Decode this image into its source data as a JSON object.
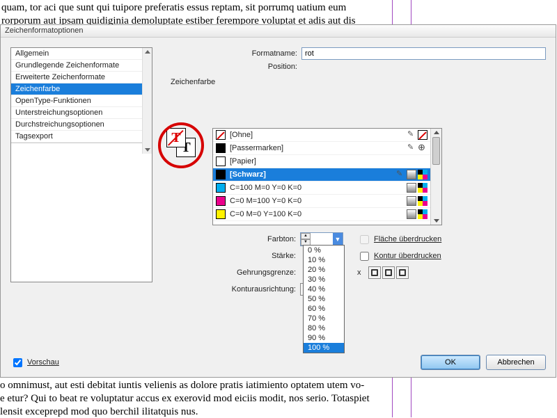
{
  "background": {
    "top": "quam, tor aci que sunt qui tuipore preferatis essus reptam, sit porrumq uatium eum\nrorporum aut ipsam quidiginia demoluptate estiber ferempore voluptat et adis aut dis",
    "bottom": "o omnimust, aut esti debitat iuntis velienis as dolore pratis iatimiento optatem utem vo-\ne etur? Qui to beat re voluptatur accus ex exerovid mod eiciis modit, nos serio. Totaspiet\nlensit exceprepd mod quo berchil ilitatquis nus."
  },
  "dialog": {
    "title": "Zeichenformatoptionen",
    "sidebar": {
      "items": [
        {
          "label": "Allgemein"
        },
        {
          "label": "Grundlegende Zeichenformate"
        },
        {
          "label": "Erweiterte Zeichenformate"
        },
        {
          "label": "Zeichenfarbe"
        },
        {
          "label": "OpenType-Funktionen"
        },
        {
          "label": "Unterstreichungsoptionen"
        },
        {
          "label": "Durchstreichungsoptionen"
        },
        {
          "label": "Tagsexport"
        }
      ],
      "selected_index": 3
    },
    "fields": {
      "formatname_label": "Formatname:",
      "formatname_value": "rot",
      "position_label": "Position:",
      "section_label": "Zeichenfarbe"
    },
    "swatches": [
      {
        "name": "[Ohne]",
        "type": "none"
      },
      {
        "name": "[Passermarken]",
        "type": "registration"
      },
      {
        "name": "[Papier]",
        "type": "paper"
      },
      {
        "name": "[Schwarz]",
        "type": "black",
        "selected": true
      },
      {
        "name": "C=100 M=0 Y=0 K=0",
        "type": "cyan"
      },
      {
        "name": "C=0 M=100 Y=0 K=0",
        "type": "magenta"
      },
      {
        "name": "C=0 M=0 Y=100 K=0",
        "type": "yellow"
      }
    ],
    "controls": {
      "tint_label": "Farbton:",
      "weight_label": "Stärke:",
      "miter_label": "Gehrungsgrenze:",
      "align_label": "Konturausrichtung:",
      "miter_x": "x",
      "overprint_fill": "Fläche überdrucken",
      "overprint_stroke": "Kontur überdrucken",
      "dropdown_options": [
        "0 %",
        "10 %",
        "20 %",
        "30 %",
        "40 %",
        "50 %",
        "60 %",
        "70 %",
        "80 %",
        "90 %",
        "100 %"
      ],
      "dropdown_selected": "100 %"
    },
    "footer": {
      "preview": "Vorschau",
      "ok": "OK",
      "cancel": "Abbrechen"
    }
  }
}
